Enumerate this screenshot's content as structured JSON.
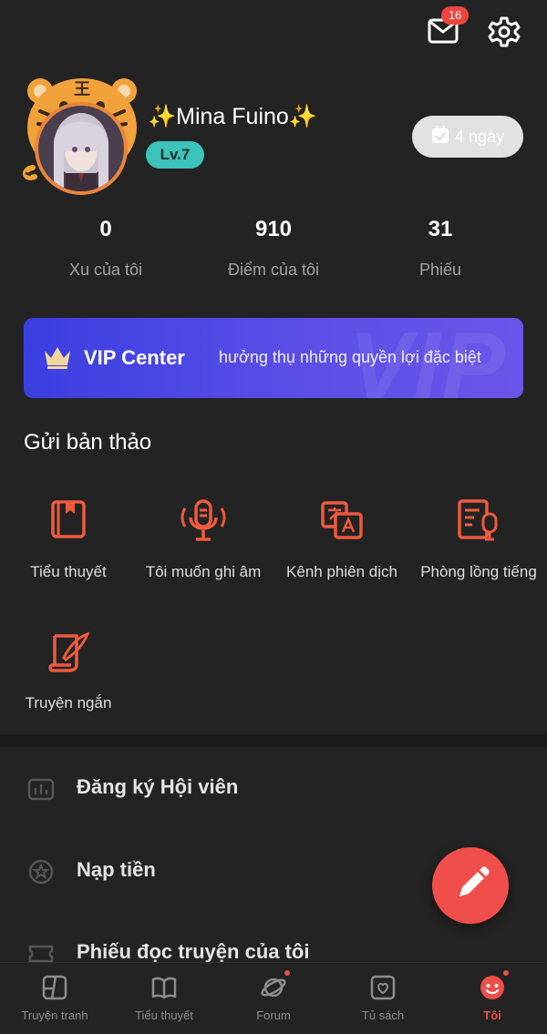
{
  "header": {
    "mail_badge_count": "16"
  },
  "profile": {
    "spark_left": "✨",
    "name": "Mina Fuino",
    "spark_right": "✨",
    "level": "Lv.7",
    "checkin_label": "4 ngày"
  },
  "stats": [
    {
      "value": "0",
      "label": "Xu của tôi"
    },
    {
      "value": "910",
      "label": "Điểm của tôi"
    },
    {
      "value": "31",
      "label": "Phiếu"
    }
  ],
  "vip": {
    "watermark": "VIP",
    "title": "VIP Center",
    "subtitle": "hưởng thụ những quyền lợi đặc biệt"
  },
  "submit_section": {
    "title": "Gửi bản thảo",
    "items": [
      {
        "label": "Tiểu thuyết",
        "icon": "book-icon"
      },
      {
        "label": "Tôi muốn ghi âm",
        "icon": "microphone-icon"
      },
      {
        "label": "Kênh phiên dịch",
        "icon": "translate-icon"
      },
      {
        "label": "Phòng lồng tiếng",
        "icon": "dubbing-icon"
      },
      {
        "label": "Truyện ngắn",
        "icon": "quill-note-icon"
      }
    ]
  },
  "menu": [
    {
      "label": "Đăng ký Hội viên",
      "icon": "membership-icon"
    },
    {
      "label": "Nạp tiền",
      "icon": "star-coin-icon"
    },
    {
      "label": "Phiếu đọc truyện của tôi",
      "icon": "ticket-icon"
    }
  ],
  "bottom_nav": [
    {
      "label": "Truyện tranh",
      "icon": "comic-icon"
    },
    {
      "label": "Tiểu thuyết",
      "icon": "open-book-icon"
    },
    {
      "label": "Forum",
      "icon": "planet-icon"
    },
    {
      "label": "Tủ sách",
      "icon": "bookshelf-icon"
    },
    {
      "label": "Tôi",
      "icon": "smile-face-icon"
    }
  ],
  "colors": {
    "background": "#232323",
    "accent_red": "#f04e4a",
    "level_teal": "#3cc3bb",
    "vip_blue": "#3a3fe0",
    "icon_orange": "#ee5a3e"
  }
}
